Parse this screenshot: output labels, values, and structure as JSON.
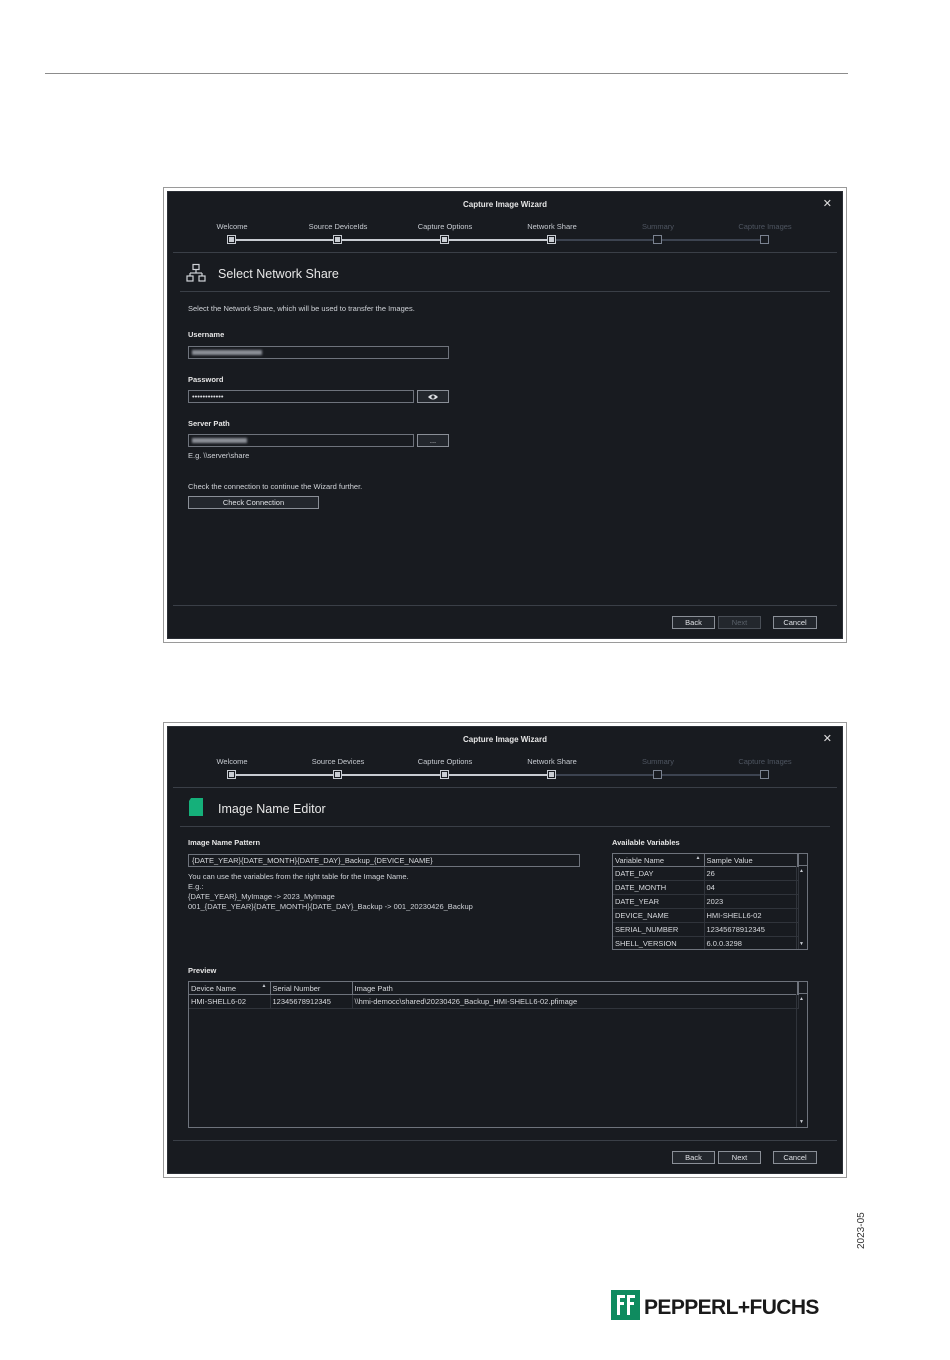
{
  "wizard1": {
    "title": "Capture Image Wizard",
    "close": "✕",
    "steps": [
      "Welcome",
      "Source DeviceIds",
      "Capture Options",
      "Network Share",
      "Summary",
      "Capture Images"
    ],
    "header": "Select Network Share",
    "intro": "Select the Network Share, which will be used to transfer the Images.",
    "username_label": "Username",
    "password_label": "Password",
    "password_value": "••••••••••••",
    "server_path_label": "Server Path",
    "browse_label": "...",
    "server_path_hint": "E.g. \\\\server\\share",
    "check_hint": "Check the connection to continue the Wizard further.",
    "check_button": "Check Connection",
    "back": "Back",
    "next": "Next",
    "cancel": "Cancel"
  },
  "wizard2": {
    "title": "Capture Image Wizard",
    "close": "✕",
    "steps": [
      "Welcome",
      "Source Devices",
      "Capture Options",
      "Network Share",
      "Summary",
      "Capture Images"
    ],
    "header": "Image Name Editor",
    "pattern_label": "Image Name Pattern",
    "pattern_value": "{DATE_YEAR}{DATE_MONTH}{DATE_DAY}_Backup_{DEVICE_NAME}",
    "help": [
      "You can use the variables from the right table for the Image Name.",
      "E.g.:",
      "{DATE_YEAR}_MyImage -> 2023_MyImage",
      "001_{DATE_YEAR}{DATE_MONTH}{DATE_DAY}_Backup -> 001_20230426_Backup"
    ],
    "variables_label": "Available Variables",
    "variables_columns": [
      "Variable Name",
      "Sample Value"
    ],
    "variables": [
      [
        "DATE_DAY",
        "26"
      ],
      [
        "DATE_MONTH",
        "04"
      ],
      [
        "DATE_YEAR",
        "2023"
      ],
      [
        "DEVICE_NAME",
        "HMI-SHELL6-02"
      ],
      [
        "SERIAL_NUMBER",
        "12345678912345"
      ],
      [
        "SHELL_VERSION",
        "6.0.0.3298"
      ]
    ],
    "preview_label": "Preview",
    "preview_columns": [
      "Device Name",
      "Serial Number",
      "Image Path"
    ],
    "preview_rows": [
      [
        "HMI-SHELL6-02",
        "12345678912345",
        "\\\\hmi-democc\\shared\\20230426_Backup_HMI-SHELL6-02.pfimage"
      ]
    ],
    "back": "Back",
    "next": "Next",
    "cancel": "Cancel"
  },
  "footer": {
    "date_code": "2023-05",
    "brand": "PEPPERL+FUCHS"
  },
  "colors": {
    "window_bg": "#181b20",
    "accent_green": "#0f8b5f",
    "step_active": "#c8ccd2"
  }
}
